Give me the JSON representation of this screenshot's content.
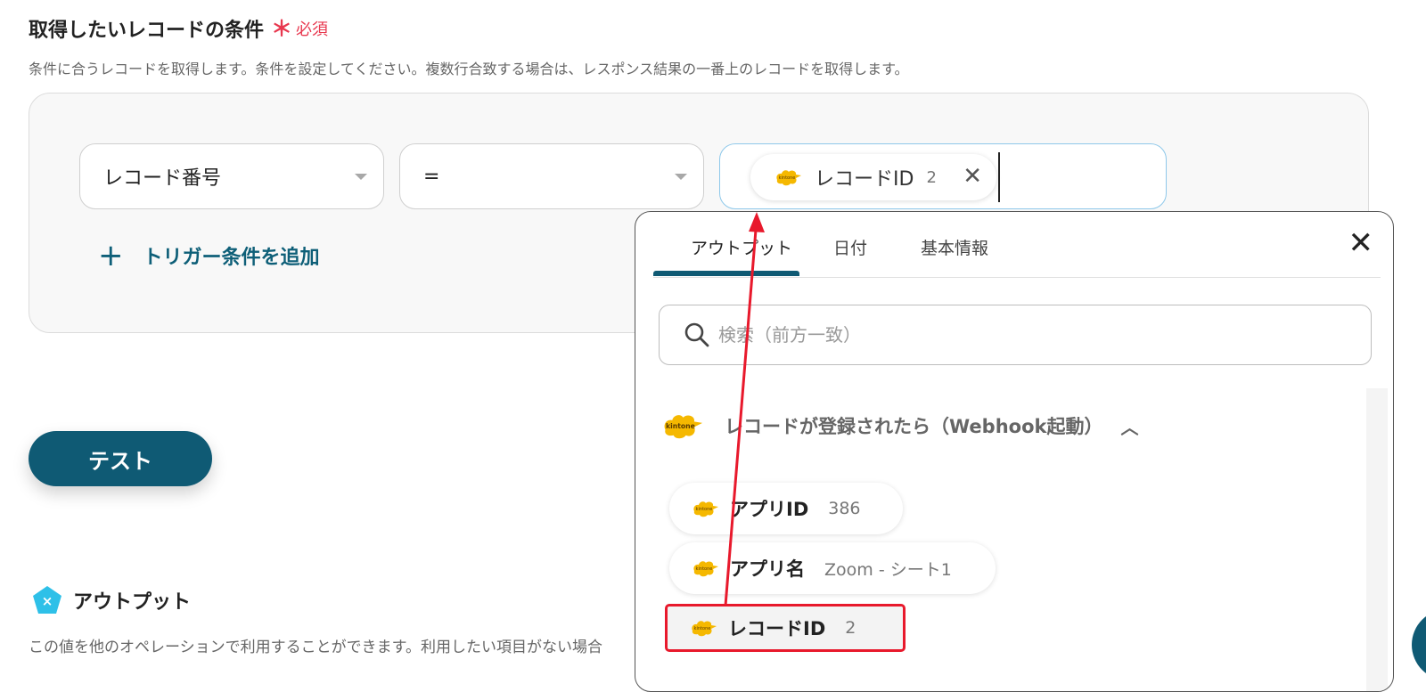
{
  "section": {
    "title": "取得したいレコードの条件",
    "required_star": "＊",
    "required_text": "必須",
    "description": "条件に合うレコードを取得します。条件を設定してください。複数行合致する場合は、レスポンス結果の一番上のレコードを取得します。"
  },
  "condition": {
    "field_value": "レコード番号",
    "operator_value": "=",
    "chip_label": "レコードID",
    "chip_number": "2",
    "add_trigger_label": "トリガー条件を追加"
  },
  "test_button": "テスト",
  "output": {
    "title": "アウトプット",
    "description": "この値を他のオペレーションで利用することができます。利用したい項目がない場合"
  },
  "popup": {
    "tabs": [
      {
        "label": "アウトプット",
        "active": true
      },
      {
        "label": "日付",
        "active": false
      },
      {
        "label": "基本情報",
        "active": false
      }
    ],
    "search_placeholder": "検索（前方一致）",
    "group_title": "レコードが登録されたら（Webhook起動）",
    "items": [
      {
        "label": "アプリID",
        "value": "386",
        "highlighted": false
      },
      {
        "label": "アプリ名",
        "value": "Zoom - シート1",
        "highlighted": false
      },
      {
        "label": "レコードID",
        "value": "2",
        "highlighted": true
      }
    ]
  },
  "logo_text": "kintone",
  "colors": {
    "accent": "#0f5a74",
    "required": "#e8384f",
    "highlight": "#e8192c",
    "kintone_yellow": "#f5b800"
  }
}
